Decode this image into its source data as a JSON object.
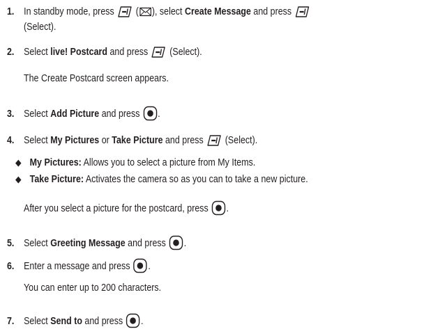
{
  "steps": [
    {
      "num": "1.",
      "a": "In standby mode, press",
      "b": "(",
      "c": "), select",
      "bold1": "Create Message",
      "d": "and press",
      "cont": "(Select)."
    },
    {
      "num": "2.",
      "a": "Select",
      "bold1": "live! Postcard",
      "b": "and press",
      "c": "(Select).",
      "note": "The Create Postcard screen appears."
    },
    {
      "num": "3.",
      "a": "Select",
      "bold1": "Add Picture",
      "b": "and press",
      "c": "."
    },
    {
      "num": "4.",
      "a": "Select",
      "bold1": "My Pictures",
      "b": "or",
      "bold2": "Take Picture",
      "c": "and press",
      "d": "(Select)."
    },
    {
      "num": "5.",
      "a": "Select",
      "bold1": "Greeting Message",
      "b": "and press",
      "c": "."
    },
    {
      "num": "6.",
      "a": "Enter a message and press",
      "c": ".",
      "note": "You can enter up to 200 characters."
    },
    {
      "num": "7.",
      "a": "Select",
      "bold1": "Send to",
      "b": "and press",
      "c": "."
    }
  ],
  "bullets": [
    {
      "symbol": "◆",
      "term": "My Pictures:",
      "text": "Allows you to select a picture from My Items."
    },
    {
      "symbol": "◆",
      "term": "Take Picture:",
      "text": "Activates the camera so as you can to take a new picture."
    }
  ],
  "after_bullets": {
    "text": "After you select a picture for the postcard, press",
    "end": "."
  },
  "icons": {
    "soft_key": "left-soft-key-icon",
    "ok_key": "ok-key-icon",
    "message": "envelope-icon"
  }
}
